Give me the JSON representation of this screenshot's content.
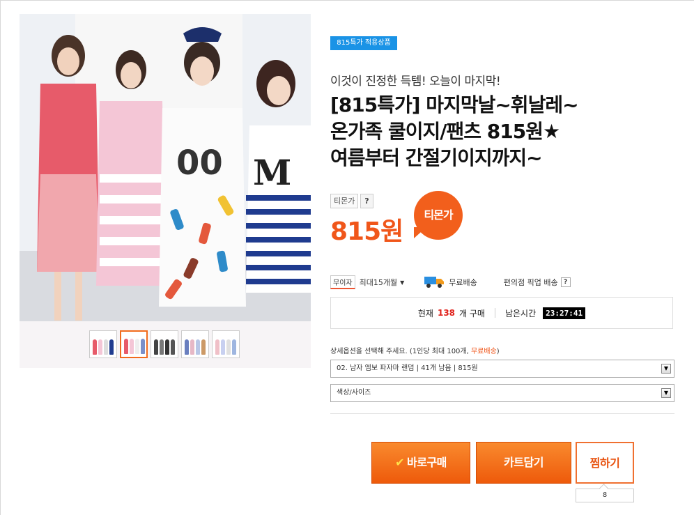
{
  "product": {
    "badge": "815특가 적용상품",
    "subtitle": "이것이 진정한 득템! 오늘이 마지막!",
    "title_lines": [
      "[815특가] 마지막날~휘날레~",
      "온가족 쿨이지/팬츠 815원★",
      "여름부터 간절기이지까지~"
    ]
  },
  "price": {
    "label": "티몬가",
    "help": "?",
    "value": "815원",
    "bubble": "티몬가"
  },
  "info": {
    "installment_badge": "무이자",
    "installment": "최대15개월",
    "shipping": "무료배송",
    "pickup": "편의점 픽업 배송",
    "pickup_help": "?"
  },
  "status": {
    "current_prefix": "현재",
    "count": "138",
    "count_suffix": "개 구매",
    "remaining_label": "남은시간",
    "timer": "23:27:41"
  },
  "options": {
    "note_prefix": "상세옵션을 선택해 주세요. (1인당 최대 100개, ",
    "note_free": "무료배송",
    "note_suffix": ")",
    "select1": "02. 남자 엠보 파자마 랜덤  |  41개 남음  |  815원",
    "select2": "색상/사이즈"
  },
  "actions": {
    "buy_now": "바로구매",
    "cart": "카트담기",
    "wish": "찜하기",
    "wish_count": "8"
  },
  "colors": {
    "accent": "#f0561a",
    "badge": "#1a93e6"
  }
}
